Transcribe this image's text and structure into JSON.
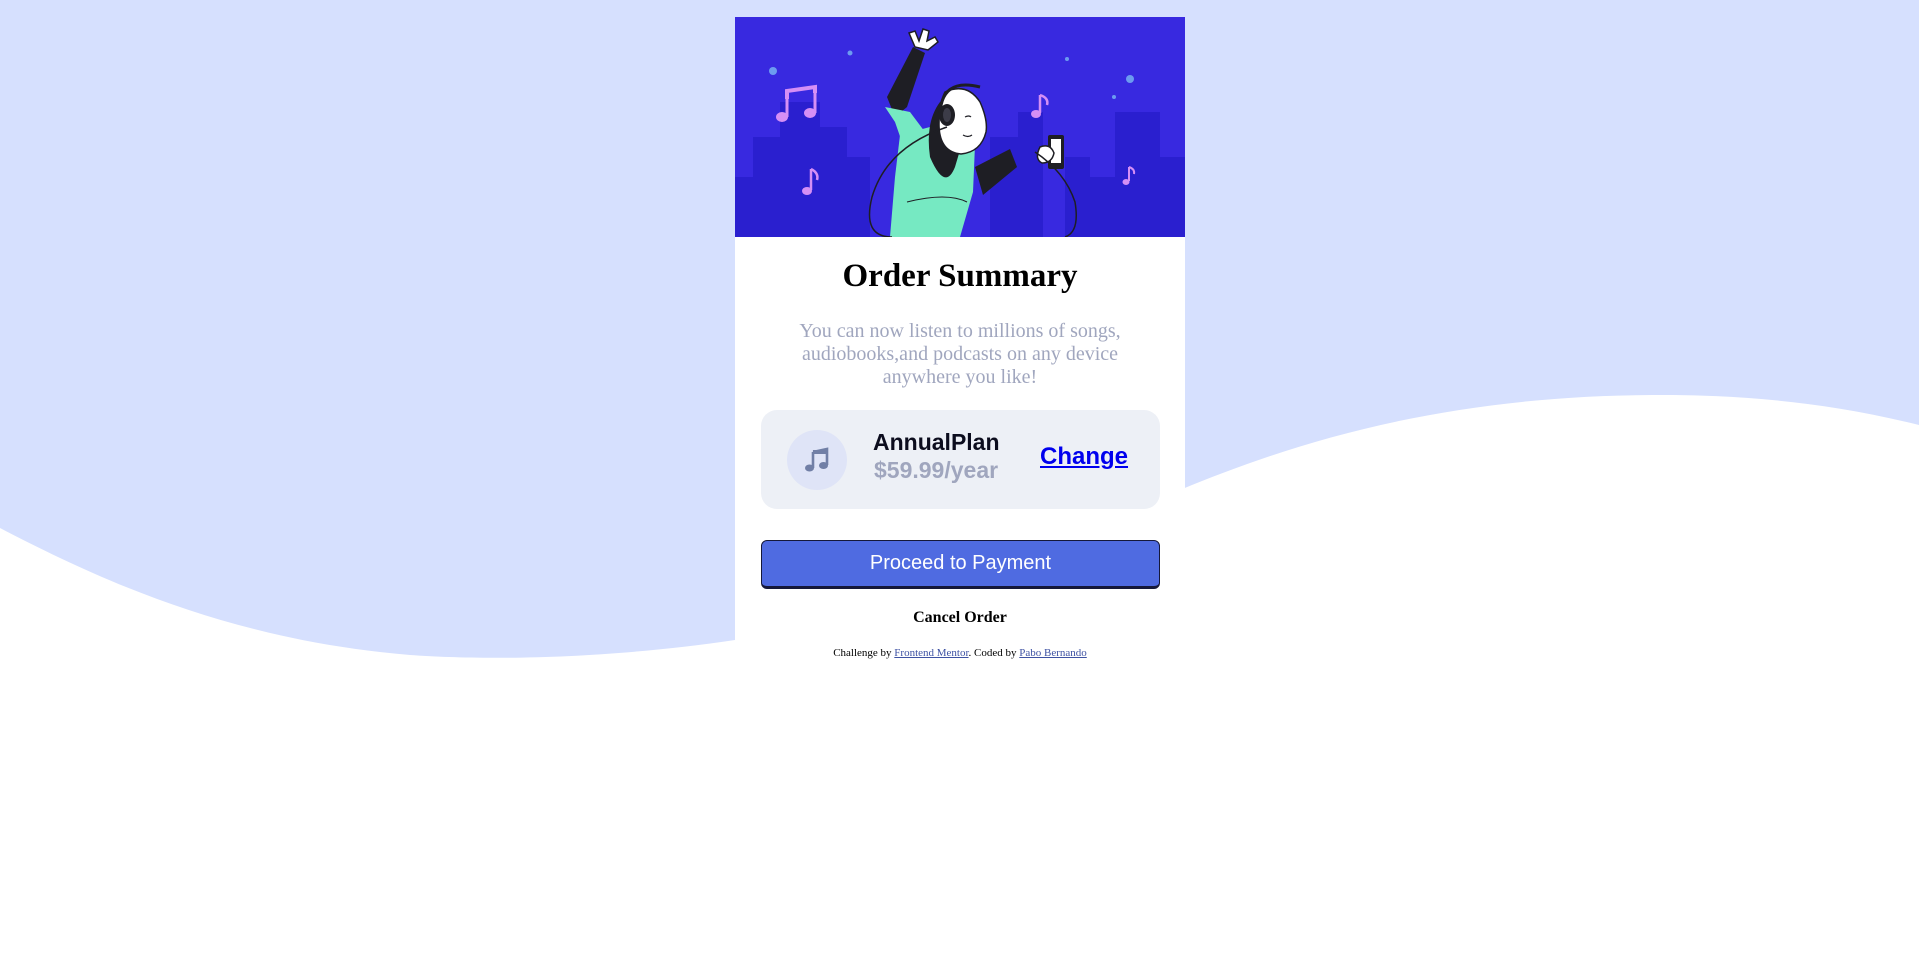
{
  "colors": {
    "background_wave": "#d6e0fe",
    "hero_bg": "#3829e0",
    "accent": "#4f6be1",
    "muted_text": "#a0a6be",
    "plan_bg": "#edf0f6"
  },
  "hero": {
    "illustration": "person-dancing-with-headphones-illustration"
  },
  "order": {
    "title": "Order Summary",
    "description": "You can now listen to millions of songs, audiobooks,and podcasts on any device anywhere you like!"
  },
  "plan": {
    "icon": "music-note-icon",
    "name": "AnnualPlan",
    "price": "$59.99/year",
    "change_label": "Change"
  },
  "actions": {
    "proceed_label": "Proceed to Payment",
    "cancel_label": "Cancel Order"
  },
  "attribution": {
    "prefix": "Challenge by ",
    "challenge_link": "Frontend Mentor",
    "middle": ". Coded by ",
    "author_link": "Pabo Bernando"
  }
}
